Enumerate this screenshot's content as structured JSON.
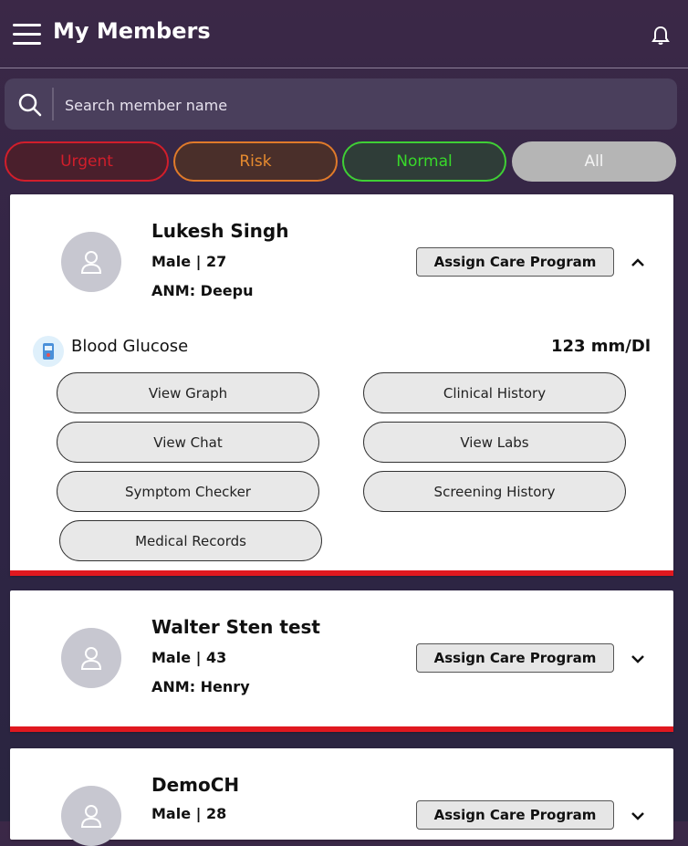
{
  "header": {
    "title": "My Members"
  },
  "search": {
    "placeholder": "Search member name"
  },
  "filters": [
    "Urgent",
    "Risk",
    "Normal",
    "All"
  ],
  "assign_label": "Assign Care Program",
  "members": [
    {
      "name": "Lukesh Singh",
      "info": "Male  | 27",
      "anm": "ANM: Deepu",
      "vital": {
        "label": "Blood Glucose",
        "value": "123 mm/Dl"
      },
      "actions": [
        "View Graph",
        "Clinical History",
        "View Chat",
        "View Labs",
        "Symptom Checker",
        "Screening History",
        "Medical Records"
      ]
    },
    {
      "name": "Walter Sten test",
      "info": "Male  | 43",
      "anm": "ANM: Henry"
    },
    {
      "name": "DemoCH",
      "info": "Male  | 28"
    }
  ]
}
